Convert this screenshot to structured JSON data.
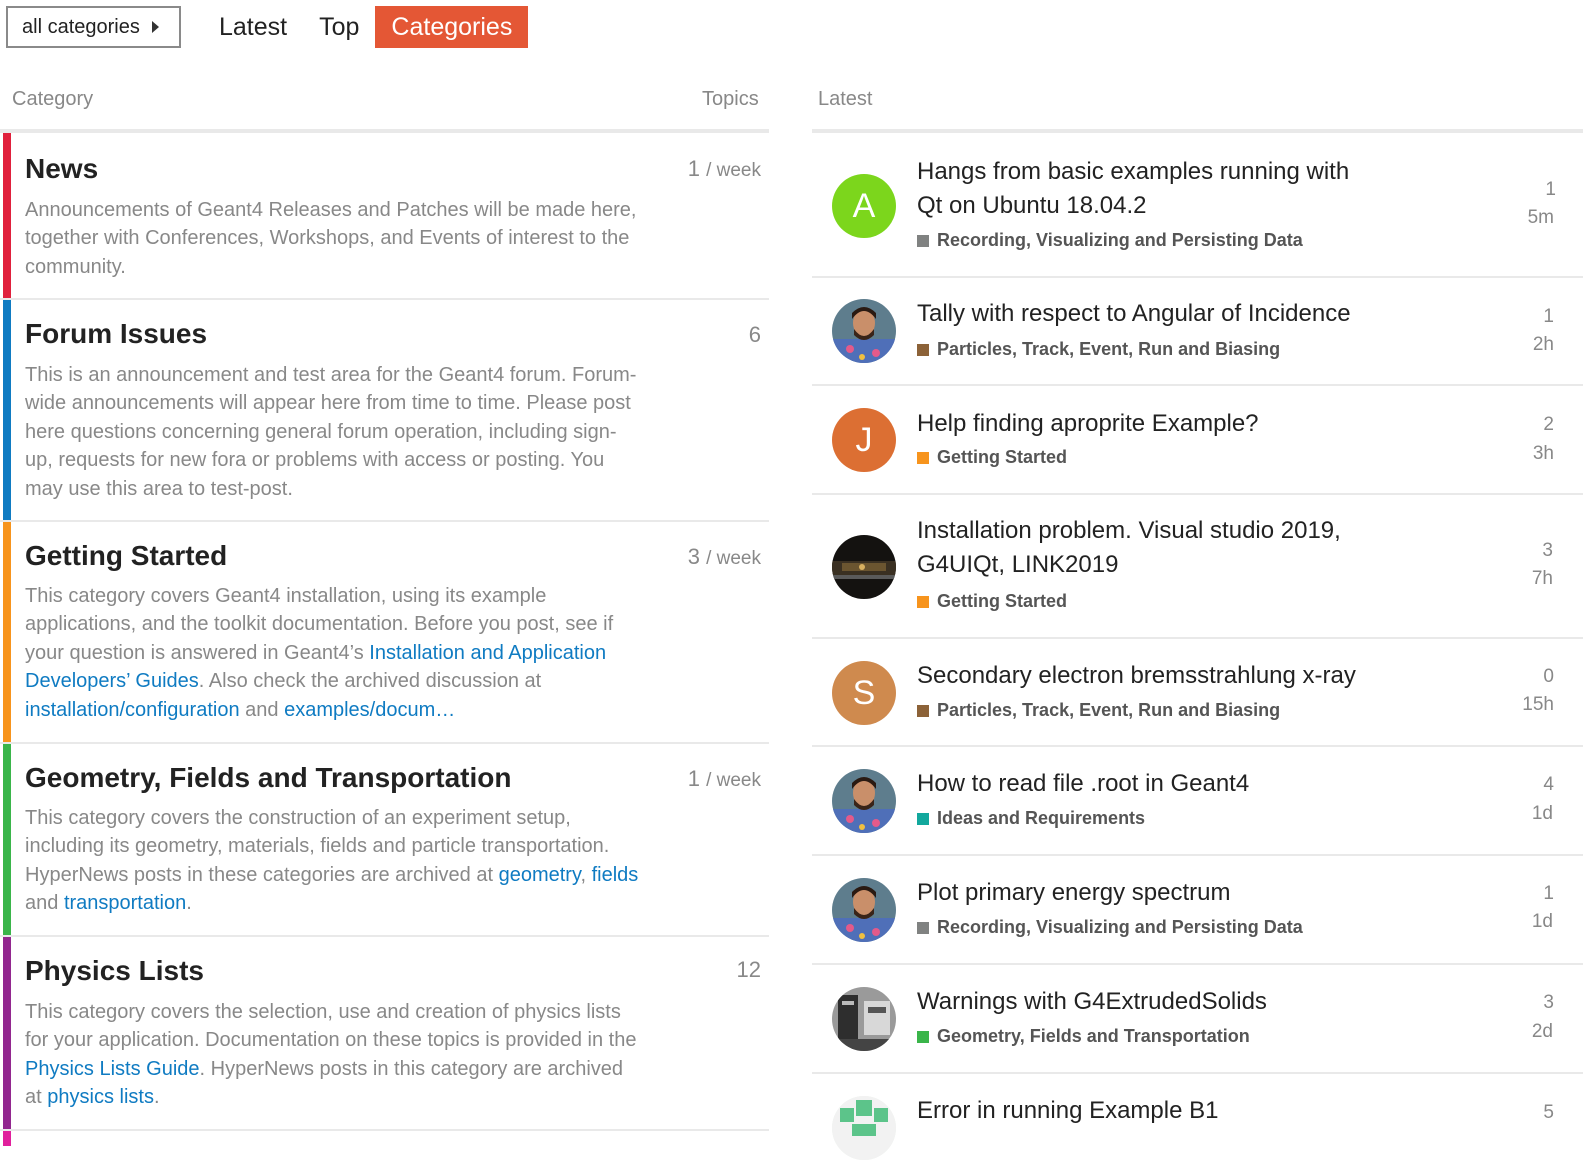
{
  "nav": {
    "category_dropdown": "all categories",
    "tabs": [
      "Latest",
      "Top",
      "Categories"
    ],
    "active_tab": "Categories"
  },
  "headers": {
    "category": "Category",
    "topics": "Topics",
    "latest": "Latest"
  },
  "colors": {
    "accent": "#e45735",
    "news": "#e0203c",
    "forum_issues": "#0f7bc2",
    "getting_started": "#f7941d",
    "geometry": "#3ab54a",
    "physics_lists": "#92278f",
    "recording": "#808281",
    "particles": "#8c6238",
    "ideas": "#12a89d"
  },
  "categories": [
    {
      "name": "News",
      "topics_num": "1",
      "topics_unit": "/ week",
      "description": "Announcements of Geant4 Releases and Patches will be made here, together with Conferences, Workshops, and Events of interest to the community."
    },
    {
      "name": "Forum Issues",
      "topics_num": "6",
      "topics_unit": "",
      "description": "This is an announcement and test area for the Geant4 forum. Forum-wide announcements will appear here from time to time. Please post here questions concerning general forum operation, including sign-up, requests for new fora or problems with access or posting. You may use this area to test-post."
    },
    {
      "name": "Getting Started",
      "topics_num": "3",
      "topics_unit": "/ week",
      "desc_1": "This category covers Geant4 installation, using its example applications, and the toolkit documentation. Before you post, see if your question is answered in Geant4’s ",
      "link_1": "Installation and Application Developers’ Guides",
      "desc_2": ". Also check the archived discussion at ",
      "link_2": "installation/configuration",
      "desc_3": " and ",
      "link_3": "examples/docum…"
    },
    {
      "name": "Geometry, Fields and Transportation",
      "topics_num": "1",
      "topics_unit": "/ week",
      "desc_1": "This category covers the construction of an experiment setup, including its geometry, materials, fields and particle transportation. HyperNews posts in these categories are archived at ",
      "link_1": "geometry",
      "desc_2": ", ",
      "link_2": "fields",
      "desc_3": " and ",
      "link_3": "transportation",
      "desc_4": "."
    },
    {
      "name": "Physics Lists",
      "topics_num": "12",
      "topics_unit": "",
      "desc_1": "This category covers the selection, use and creation of physics lists for your application. Documentation on these topics is provided in the ",
      "link_1": "Physics Lists Guide",
      "desc_2": ". HyperNews posts in this category are archived at ",
      "link_2": "physics lists",
      "desc_3": "."
    }
  ],
  "topics": [
    {
      "title": "Hangs from basic examples running with Qt on Ubuntu 18.04.2",
      "category": "Recording, Visualizing and Persisting Data",
      "replies": "1",
      "age": "5m",
      "avatar_letter": "A",
      "avatar_color": "#7cd61c"
    },
    {
      "title": "Tally with respect to Angular of Incidence",
      "category": "Particles, Track, Event, Run and Biasing",
      "replies": "1",
      "age": "2h",
      "avatar_letter": "",
      "avatar_color": "#3a6a8a"
    },
    {
      "title": "Help finding aproprite Example?",
      "category": "Getting Started",
      "replies": "2",
      "age": "3h",
      "avatar_letter": "J",
      "avatar_color": "#dc6f33"
    },
    {
      "title": "Installation problem. Visual studio 2019, G4UIQt, LINK2019",
      "category": "Getting Started",
      "replies": "3",
      "age": "7h",
      "avatar_letter": "",
      "avatar_color": "#1e1a14"
    },
    {
      "title": "Secondary electron bremsstrahlung x-ray",
      "category": "Particles, Track, Event, Run and Biasing",
      "replies": "0",
      "age": "15h",
      "avatar_letter": "S",
      "avatar_color": "#cf8a4e"
    },
    {
      "title": "How to read file .root in Geant4",
      "category": "Ideas and Requirements",
      "replies": "4",
      "age": "1d",
      "avatar_letter": "",
      "avatar_color": "#3a6a8a"
    },
    {
      "title": "Plot primary energy spectrum",
      "category": "Recording, Visualizing and Persisting Data",
      "replies": "1",
      "age": "1d",
      "avatar_letter": "",
      "avatar_color": "#3a6a8a"
    },
    {
      "title": "Warnings with G4ExtrudedSolids",
      "category": "Geometry, Fields and Transportation",
      "replies": "3",
      "age": "2d",
      "avatar_letter": "",
      "avatar_color": "#777777"
    },
    {
      "title": "Error in running Example B1",
      "category": "",
      "replies": "5",
      "age": "",
      "avatar_letter": "",
      "avatar_color": "#5cc48a"
    }
  ]
}
